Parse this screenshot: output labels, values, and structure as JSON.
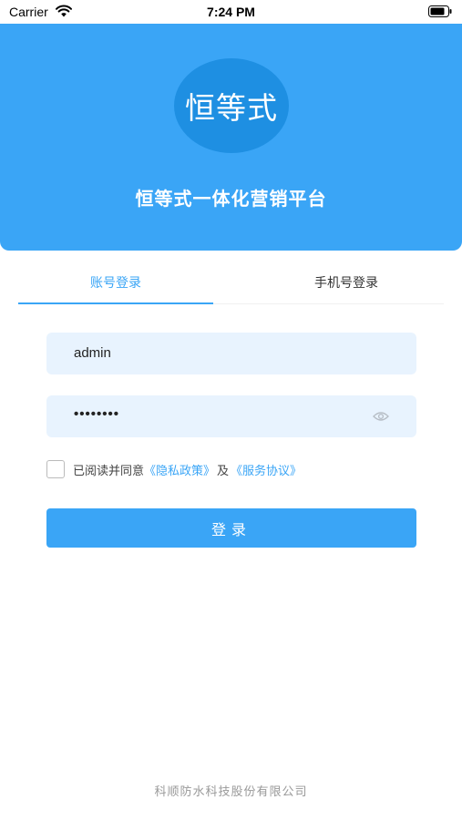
{
  "status_bar": {
    "carrier": "Carrier",
    "time": "7:24 PM"
  },
  "header": {
    "logo_text": "恒等式",
    "title": "恒等式一体化营销平台"
  },
  "tabs": [
    {
      "label": "账号登录",
      "active": true
    },
    {
      "label": "手机号登录",
      "active": false
    }
  ],
  "form": {
    "username_value": "admin",
    "password_value": "••••••••"
  },
  "agreement": {
    "checked": false,
    "prefix": "已阅读并同意",
    "privacy_link": "《隐私政策》",
    "and": "及",
    "service_link": "《服务协议》"
  },
  "login_button": "登录",
  "footer": "科顺防水科技股份有限公司",
  "colors": {
    "accent": "#3aa5f6",
    "field_bg": "#e8f3fe"
  }
}
